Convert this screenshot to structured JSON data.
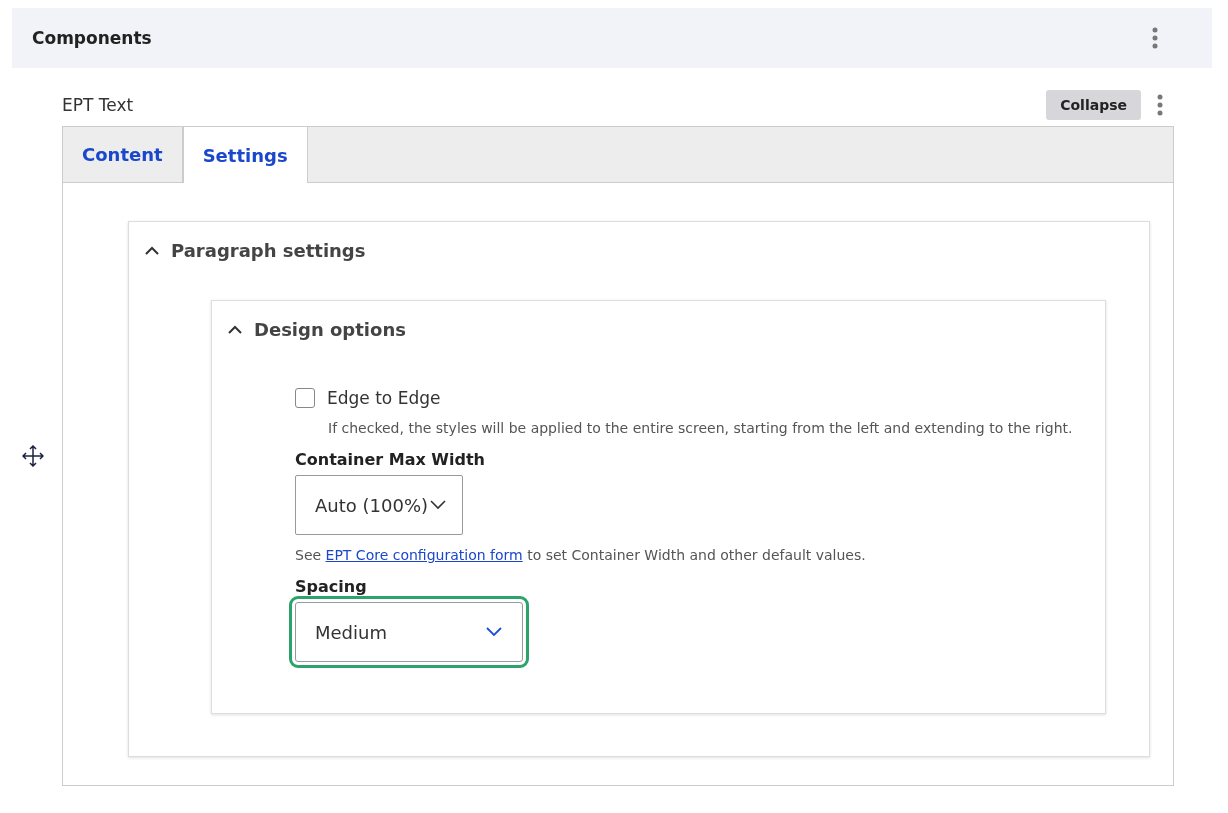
{
  "section": {
    "title": "Components"
  },
  "component": {
    "title": "EPT Text",
    "collapse_button": "Collapse"
  },
  "tabs": [
    {
      "label": "Content",
      "selected": false
    },
    {
      "label": "Settings",
      "selected": true
    }
  ],
  "paragraph_settings": {
    "title": "Paragraph settings",
    "expanded": true
  },
  "design_options": {
    "title": "Design options",
    "expanded": true
  },
  "edge_to_edge": {
    "label": "Edge to Edge",
    "checked": false,
    "description": "If checked, the styles will be applied to the entire screen, starting from the left and extending to the right."
  },
  "container_max_width": {
    "label": "Container Max Width",
    "value": "Auto (100%)",
    "focused": false,
    "help_before": "See",
    "help_link": "EPT Core configuration form",
    "help_after": "to set Container Width and other default values."
  },
  "spacing": {
    "label": "Spacing",
    "value": "Medium",
    "focused": true
  }
}
